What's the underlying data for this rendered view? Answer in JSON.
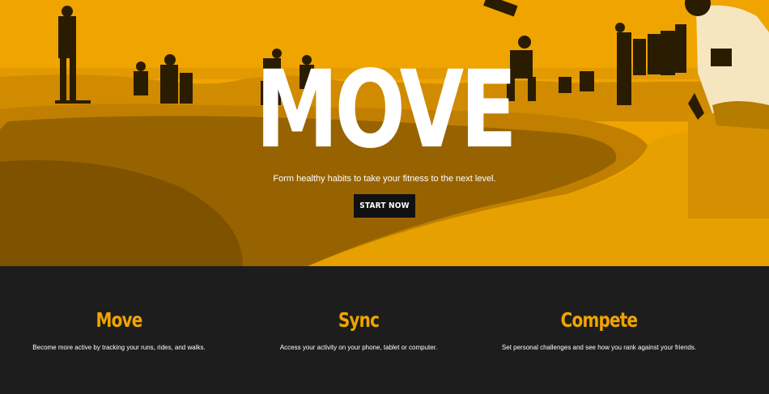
{
  "hero": {
    "title": "MOVE",
    "subtitle": "Form healthy habits to take your fitness to the next level.",
    "cta_label": "START NOW",
    "accent_color": "#f0a400"
  },
  "features": [
    {
      "title": "Move",
      "description": "Become more active by tracking your runs, rides, and walks."
    },
    {
      "title": "Sync",
      "description": "Access your activity on your phone, tablet or computer."
    },
    {
      "title": "Compete",
      "description": "Set personal challenges and see how you rank against your friends."
    }
  ],
  "colors": {
    "accent": "#f0a400",
    "dark": "#1d1d1d",
    "button": "#111111",
    "text": "#ffffff"
  }
}
